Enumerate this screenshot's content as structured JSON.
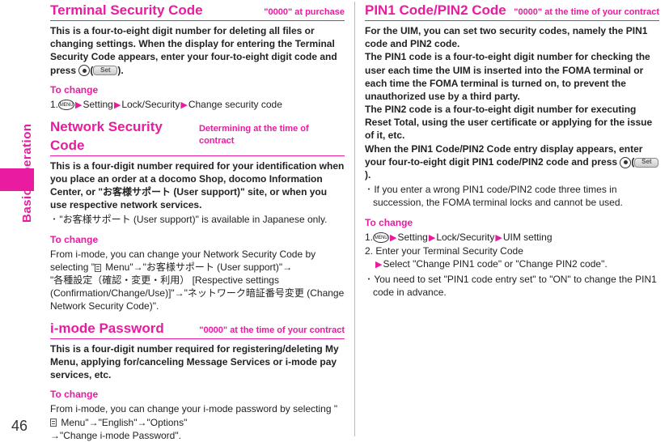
{
  "page_number": "46",
  "side_tab": "Basic Operation",
  "left": {
    "s1": {
      "title": "Terminal Security Code",
      "sub": "\"0000\" at purchase",
      "body": "This is a four-to-eight digit number for deleting all files or changing settings. When the display for entering the Terminal Security Code appears, enter your four-to-eight digit code and press ",
      "body_after": "(",
      "body_end": ").",
      "change_h": "To change",
      "change_1a": "1.",
      "change_1b": "Setting",
      "change_1c": "Lock/Security",
      "change_1d": "Change security code",
      "menu_label": "MENU",
      "set_label": "Set"
    },
    "s2": {
      "title": "Network Security Code",
      "sub": "Determining at the time of contract",
      "body": "This is a four-digit number required for your identification when you place an order at a docomo Shop, docomo Information Center, or \"お客様サポート (User support)\" site, or when you use respective network services.",
      "note": "･ \"お客様サポート (User support)\" is available in Japanese only.",
      "change_h": "To change",
      "p1": "From i-mode, you can change your Network Security Code by selecting \"",
      "imenu": " Menu\"→\"お客様サポート (User support)\"→",
      "p2": "\"各種設定（確認・変更・利用） [Respective settings (Confirmation/Change/Use)]\"→\"ネットワーク暗証番号変更 (Change Network Security Code)\"."
    },
    "s3": {
      "title": "i-mode Password",
      "sub": "\"0000\" at the time of your contract",
      "body": "This is a four-digit number required for registering/deleting My Menu, applying for/canceling Message Services or i-mode pay services, etc.",
      "change_h": "To change",
      "p1": "From i-mode, you can change your i-mode password by selecting \"",
      "imenu": " Menu\"→\"English\"→\"Options\"",
      "p2": "→\"Change i-mode Password\"."
    }
  },
  "right": {
    "s1": {
      "title": "PIN1 Code/PIN2 Code",
      "sub": "\"0000\" at the time of your contract",
      "body1": "For the UIM, you can set two security codes, namely the PIN1 code and PIN2 code.",
      "body2": "The PIN1 code is a four-to-eight digit number for checking the user each time the UIM is inserted into the FOMA terminal or each time the FOMA terminal is turned on, to prevent the unauthorized use by a third party.",
      "body3": "The PIN2 code is a four-to-eight digit number for executing Reset Total, using the user certificate or applying for the issue of it, etc.",
      "body4": "When the PIN1 Code/PIN2 Code entry display appears, enter your four-to-eight digit PIN1 code/PIN2 code and press ",
      "body4_after": "(",
      "body4_end": ").",
      "set_label": "Set",
      "note": "･ If you enter a wrong PIN1 code/PIN2 code three times in succession, the FOMA terminal locks and cannot be used.",
      "change_h": "To change",
      "menu_label": "MENU",
      "c1a": "1.",
      "c1b": "Setting",
      "c1c": "Lock/Security",
      "c1d": "UIM setting",
      "c2": "2. Enter your Terminal Security Code",
      "c2b": "Select \"Change PIN1 code\" or \"Change PIN2 code\".",
      "c3": "･ You need to set \"PIN1 code entry set\" to \"ON\" to change the PIN1 code in advance."
    }
  }
}
